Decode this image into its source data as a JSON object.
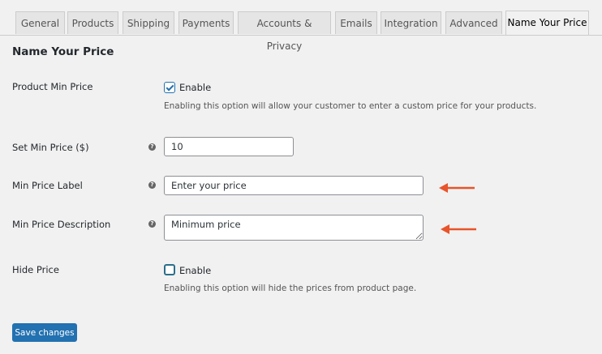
{
  "tabs": [
    {
      "label": "General",
      "active": false
    },
    {
      "label": "Products",
      "active": false
    },
    {
      "label": "Shipping",
      "active": false
    },
    {
      "label": "Payments",
      "active": false
    },
    {
      "label": "Accounts & Privacy",
      "active": false
    },
    {
      "label": "Emails",
      "active": false
    },
    {
      "label": "Integration",
      "active": false
    },
    {
      "label": "Advanced",
      "active": false
    },
    {
      "label": "Name Your Price",
      "active": true
    }
  ],
  "section_title": "Name Your Price",
  "fields": {
    "product_min_price": {
      "label": "Product Min Price",
      "checkbox_label": "Enable",
      "checked": true,
      "description": "Enabling this option will allow your customer to enter a custom price for your products."
    },
    "set_min_price": {
      "label": "Set Min Price ($)",
      "value": "10"
    },
    "min_price_label": {
      "label": "Min Price Label",
      "value": "Enter your price"
    },
    "min_price_description": {
      "label": "Min Price Description",
      "value": "Minimum price"
    },
    "hide_price": {
      "label": "Hide Price",
      "checkbox_label": "Enable",
      "checked": false,
      "description": "Enabling this option will hide the prices from product page."
    }
  },
  "help_icon": "?",
  "save_button": "Save changes",
  "colors": {
    "primary": "#2271b1",
    "annotation_arrow": "#e8542b",
    "background": "#f1f1f1"
  }
}
